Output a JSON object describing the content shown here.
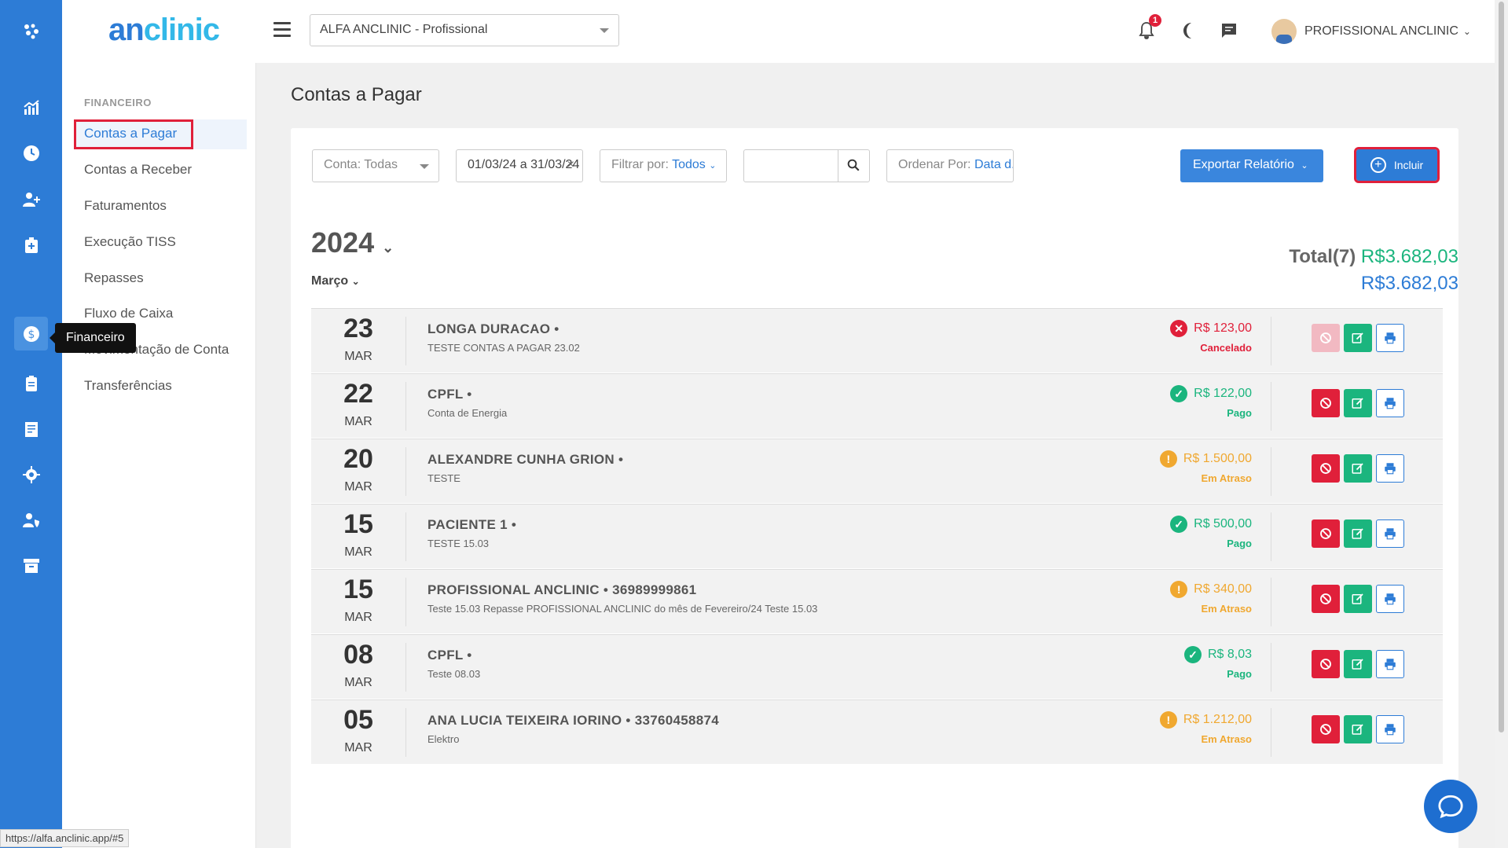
{
  "app": {
    "logo_a": "an",
    "logo_b": "clinic",
    "clinic_selector": "ALFA ANCLINIC - Profissional",
    "notification_count": "1",
    "user_name": "PROFISSIONAL ANCLINIC"
  },
  "rail": {
    "tooltip": "Financeiro",
    "icons": [
      "grid-icon",
      "chart-icon",
      "clock-icon",
      "add-user-icon",
      "medical-bag-icon",
      "finance-icon",
      "clipboard-icon",
      "report-icon",
      "settings-icon",
      "user-shield-icon",
      "archive-icon"
    ]
  },
  "menu": {
    "section": "FINANCEIRO",
    "items": [
      "Contas a Pagar",
      "Contas a Receber",
      "Faturamentos",
      "Execução TISS",
      "Repasses",
      "Fluxo de Caixa",
      "Movimentação de Conta",
      "Transferências"
    ]
  },
  "page": {
    "title": "Contas a Pagar"
  },
  "filters": {
    "account": "Conta: Todas",
    "date_range": "01/03/24 a 31/03/24",
    "date_clear": "×",
    "filter_label": "Filtrar por:",
    "filter_value": "Todos",
    "search_value": "",
    "order_label": "Ordenar Por:",
    "order_value": "Data d...",
    "export": "Exportar Relatório",
    "add": "Incluir"
  },
  "listing": {
    "year": "2024",
    "month": "Março",
    "total_label": "Total(7)",
    "total_green": "R$3.682,03",
    "total_blue": "R$3.682,03"
  },
  "colors": {
    "primary": "#2d7cd6",
    "green": "#1bb57e",
    "red": "#e0203a",
    "orange": "#f0a830"
  },
  "rows": [
    {
      "day": "23",
      "mon": "MAR",
      "name": "LONGA DURACAO •",
      "desc": "TESTE CONTAS A PAGAR 23.02",
      "amount": "R$ 123,00",
      "status": "Cancelado",
      "state": "cancel"
    },
    {
      "day": "22",
      "mon": "MAR",
      "name": "CPFL •",
      "desc": "Conta de Energia",
      "amount": "R$ 122,00",
      "status": "Pago",
      "state": "paid"
    },
    {
      "day": "20",
      "mon": "MAR",
      "name": "ALEXANDRE CUNHA GRION •",
      "desc": "TESTE",
      "amount": "R$ 1.500,00",
      "status": "Em Atraso",
      "state": "late"
    },
    {
      "day": "15",
      "mon": "MAR",
      "name": "PACIENTE 1 •",
      "desc": "TESTE 15.03",
      "amount": "R$ 500,00",
      "status": "Pago",
      "state": "paid"
    },
    {
      "day": "15",
      "mon": "MAR",
      "name": "PROFISSIONAL ANCLINIC • 36989999861",
      "desc": "Teste 15.03 Repasse PROFISSIONAL ANCLINIC do mês de Fevereiro/24 Teste 15.03",
      "amount": "R$ 340,00",
      "status": "Em Atraso",
      "state": "late"
    },
    {
      "day": "08",
      "mon": "MAR",
      "name": "CPFL •",
      "desc": "Teste 08.03",
      "amount": "R$ 8,03",
      "status": "Pago",
      "state": "paid"
    },
    {
      "day": "05",
      "mon": "MAR",
      "name": "ANA LUCIA TEIXEIRA IORINO • 33760458874",
      "desc": "Elektro",
      "amount": "R$ 1.212,00",
      "status": "Em Atraso",
      "state": "late"
    }
  ],
  "status_bar": {
    "url": "https://alfa.anclinic.app/#5"
  }
}
